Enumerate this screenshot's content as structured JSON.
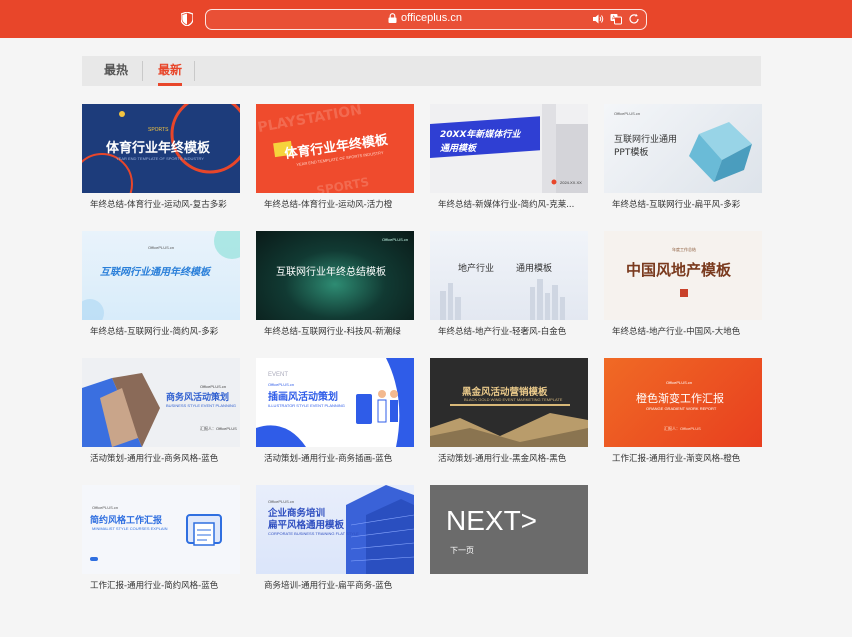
{
  "browser": {
    "url": "officeplus.cn",
    "accent": "#e8462a"
  },
  "tabs": [
    {
      "label": "最热",
      "active": false
    },
    {
      "label": "最新",
      "active": true
    }
  ],
  "cards": [
    {
      "caption": "年终总结-体育行业-运动风-复古多彩",
      "thumb_title": "体育行业年终模板",
      "thumb_sub": "YEAR END TEMPLATE OF SPORTS INDUSTRY",
      "tag": "SPORTS"
    },
    {
      "caption": "年终总结-体育行业-运动风-活力橙",
      "thumb_title": "体育行业年终模板",
      "thumb_sub": "YEAR END TEMPLATE OF SPORTS INDUSTRY"
    },
    {
      "caption": "年终总结-新媒体行业-简约风-克莱...",
      "thumb_title": "20XX年新媒体行业",
      "thumb_title2": "通用模板",
      "thumb_sub": "2024.XX.XX"
    },
    {
      "caption": "年终总结-互联网行业-扁平风-多彩",
      "thumb_title": "互联网行业通用",
      "thumb_title2": "PPT模板",
      "brand": "OfficePLUS.cn"
    },
    {
      "caption": "年终总结-互联网行业-简约风-多彩",
      "thumb_title": "互联网行业通用年终模板",
      "brand": "OfficePLUS.cn"
    },
    {
      "caption": "年终总结-互联网行业-科技风-新潮绿",
      "thumb_title": "互联网行业年终总结模板",
      "brand": "OfficePLUS.cn"
    },
    {
      "caption": "年终总结-地产行业-轻奢风-白金色",
      "thumb_title": "地产行业",
      "thumb_title2": "通用模板"
    },
    {
      "caption": "年终总结-地产行业-中国风-大地色",
      "thumb_title": "中国风地产模板",
      "thumb_sub": "年度工作总结"
    },
    {
      "caption": "活动策划-通用行业-商务风格-蓝色",
      "thumb_title": "商务风活动策划",
      "thumb_sub": "BUSINESS STYLE EVENT PLANNING",
      "brand": "OfficePLUS.cn",
      "presenter": "汇报人：OfficePLUS"
    },
    {
      "caption": "活动策划-通用行业-商务插画-蓝色",
      "thumb_title": "插画风活动策划",
      "thumb_sub": "ILLUSTRATOR STYLE EVENT PLANNING",
      "brand": "OfficePLUS.cn",
      "tag": "EVENT"
    },
    {
      "caption": "活动策划-通用行业-黑金风格-黑色",
      "thumb_title": "黑金风活动营销模板",
      "thumb_sub": "BLACK GOLD WIND EVENT MARKETING TEMPLATE"
    },
    {
      "caption": "工作汇报-通用行业-渐变风格-橙色",
      "thumb_title": "橙色渐变工作汇报",
      "thumb_sub": "ORANGE GRADIENT WORK REPORT",
      "brand": "OfficePLUS.cn",
      "presenter": "汇报人：OfficePLUS"
    },
    {
      "caption": "工作汇报-通用行业-简约风格-蓝色",
      "thumb_title": "简约风格工作汇报",
      "thumb_sub": "MINIMALIST STYLE COURSES EXPLAIN",
      "brand": "OfficePLUS.cn"
    },
    {
      "caption": "商务培训-通用行业-扁平商务-蓝色",
      "thumb_title": "企业商务培训",
      "thumb_title2": "扁平风格通用模板",
      "thumb_sub": "CORPORATE BUSINESS TRAINING FLAT STYLE",
      "brand": "OfficePLUS.cn"
    }
  ],
  "next": {
    "label": "NEXT>",
    "sub": "下一页"
  }
}
